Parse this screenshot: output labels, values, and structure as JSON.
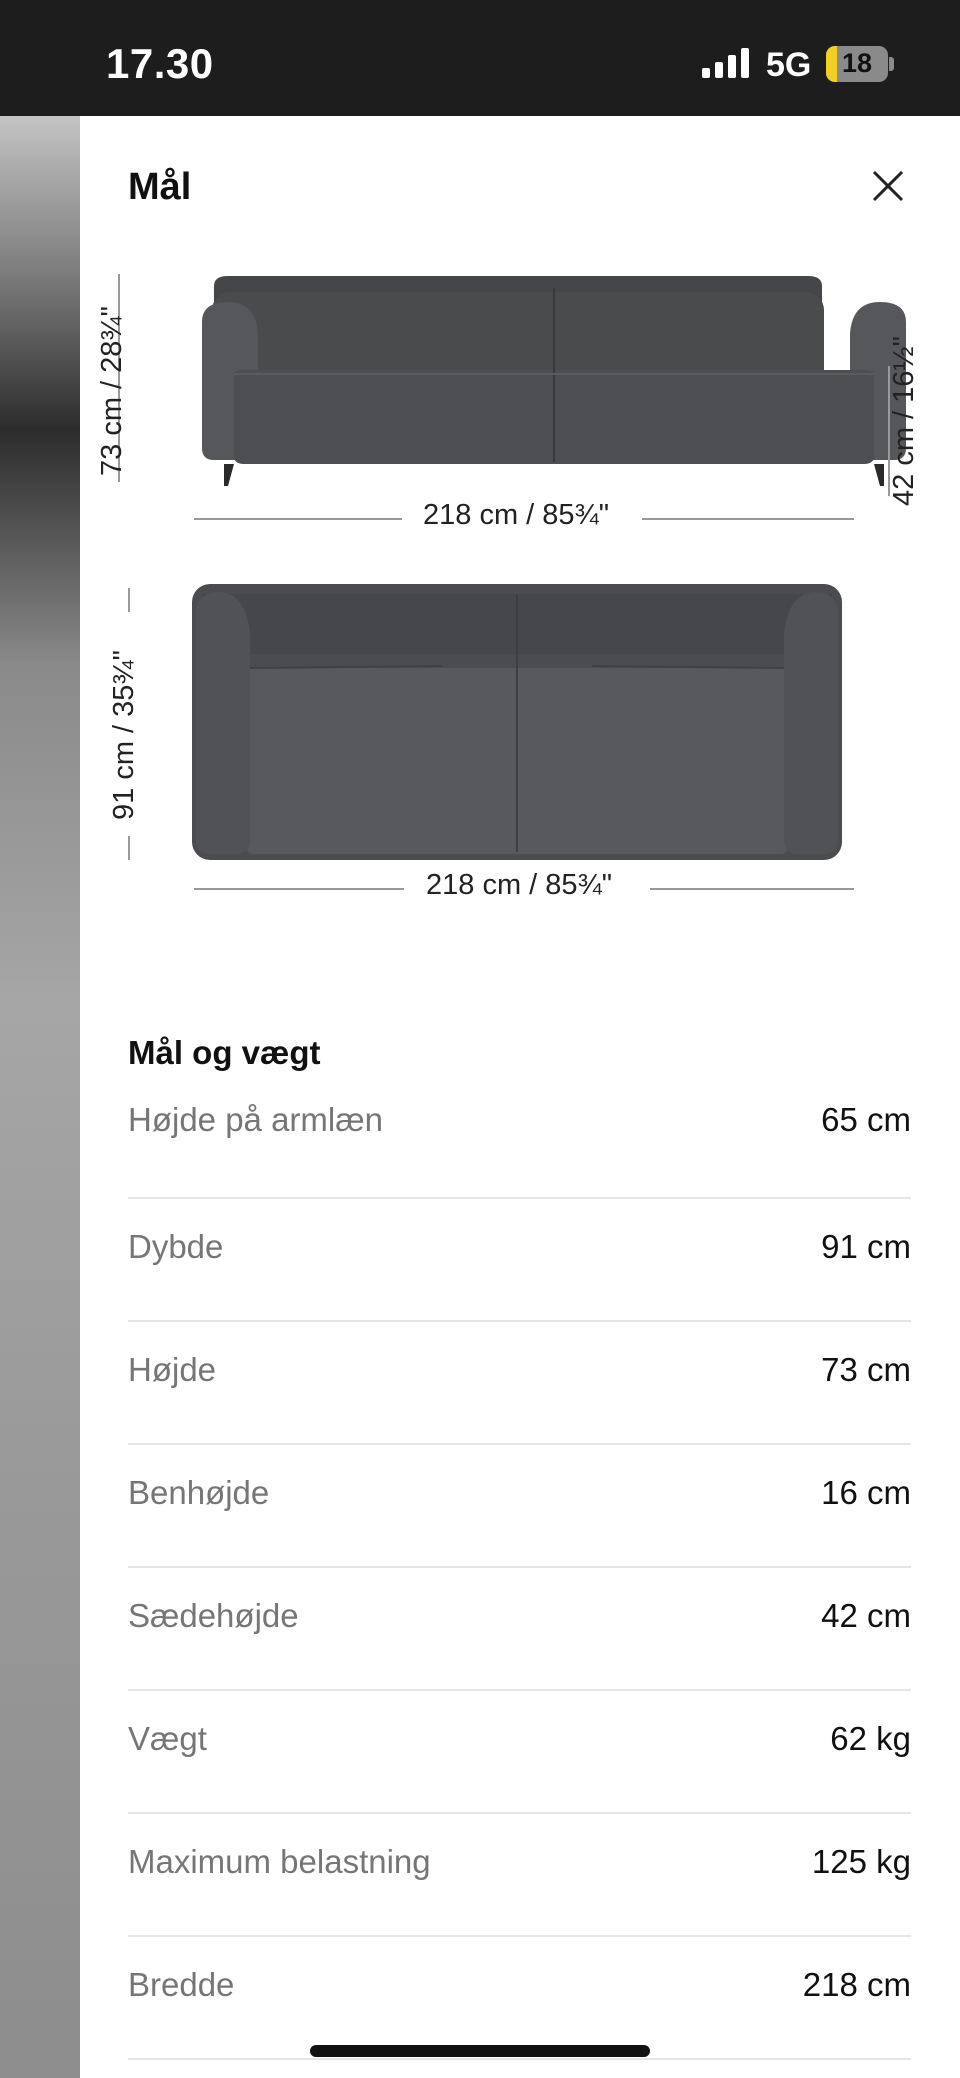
{
  "status_bar": {
    "time": "17.30",
    "network": "5G",
    "battery_level": "18",
    "battery_fraction": 0.18,
    "signal_bars": 4
  },
  "sheet": {
    "title": "Mål",
    "close_icon": "close-icon"
  },
  "diagram": {
    "front_height": "73 cm / 28¾\"",
    "seat_height": "42 cm / 16½\"",
    "front_width": "218 cm / 85¾\"",
    "top_depth": "91 cm / 35¾\"",
    "top_width": "218 cm / 85¾\"",
    "sofa_color": "#4a4b4d"
  },
  "specs": {
    "heading": "Mål og vægt",
    "rows": [
      {
        "label": "Højde på armlæn",
        "value": "65 cm"
      },
      {
        "label": "Dybde",
        "value": "91 cm"
      },
      {
        "label": "Højde",
        "value": "73 cm"
      },
      {
        "label": "Benhøjde",
        "value": "16 cm"
      },
      {
        "label": "Sædehøjde",
        "value": "42 cm"
      },
      {
        "label": "Vægt",
        "value": "62 kg"
      },
      {
        "label": "Maximum belastning",
        "value": "125 kg"
      },
      {
        "label": "Bredde",
        "value": "218 cm"
      }
    ]
  }
}
